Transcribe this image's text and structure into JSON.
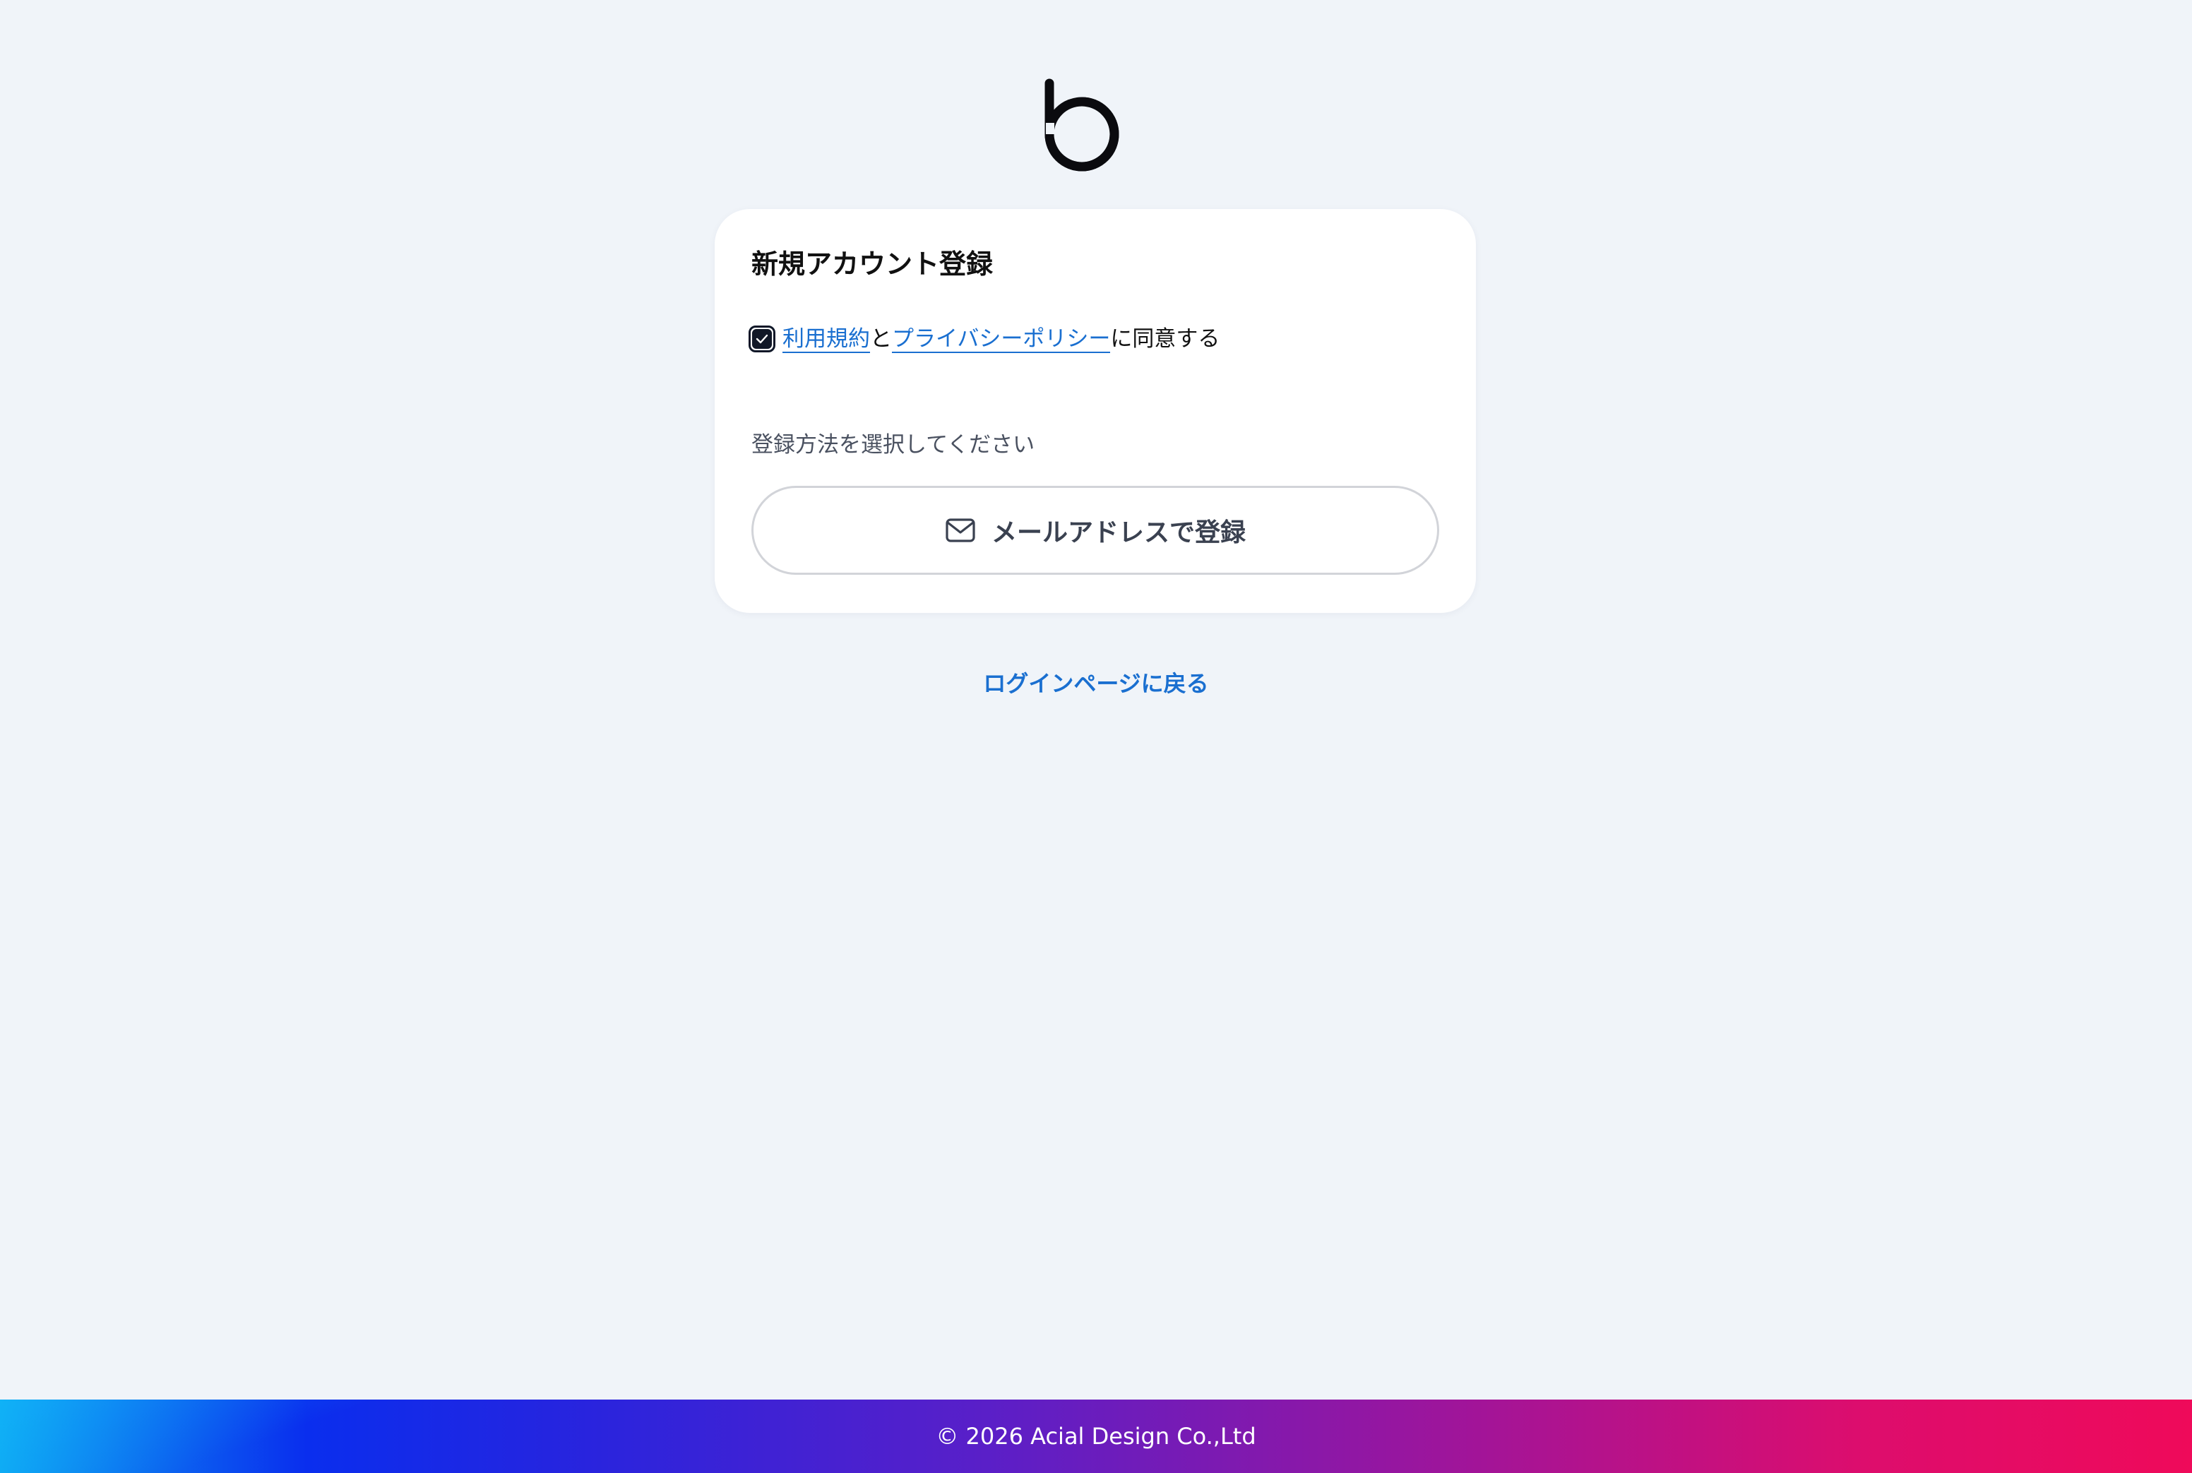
{
  "brand": {
    "logo_colors": {
      "b": "#0b0b0f",
      "plus_gradient_start": "#3b3bf0",
      "plus_gradient_end": "#ef0a5a"
    }
  },
  "card": {
    "title": "新規アカウント登録",
    "agreement": {
      "checked": true,
      "terms_link": "利用規約",
      "connector": "と",
      "privacy_link": "プライバシーポリシー",
      "suffix": "に同意する"
    },
    "method_label": "登録方法を選択してください",
    "email_button": {
      "icon": "mail-icon",
      "label": "メールアドレスで登録"
    }
  },
  "back_link": "ログインページに戻る",
  "footer": {
    "copyright": "© 2026 Acial Design Co.,Ltd"
  },
  "colors": {
    "background": "#f0f4f9",
    "link": "#1a6fd0",
    "card": "#ffffff"
  }
}
